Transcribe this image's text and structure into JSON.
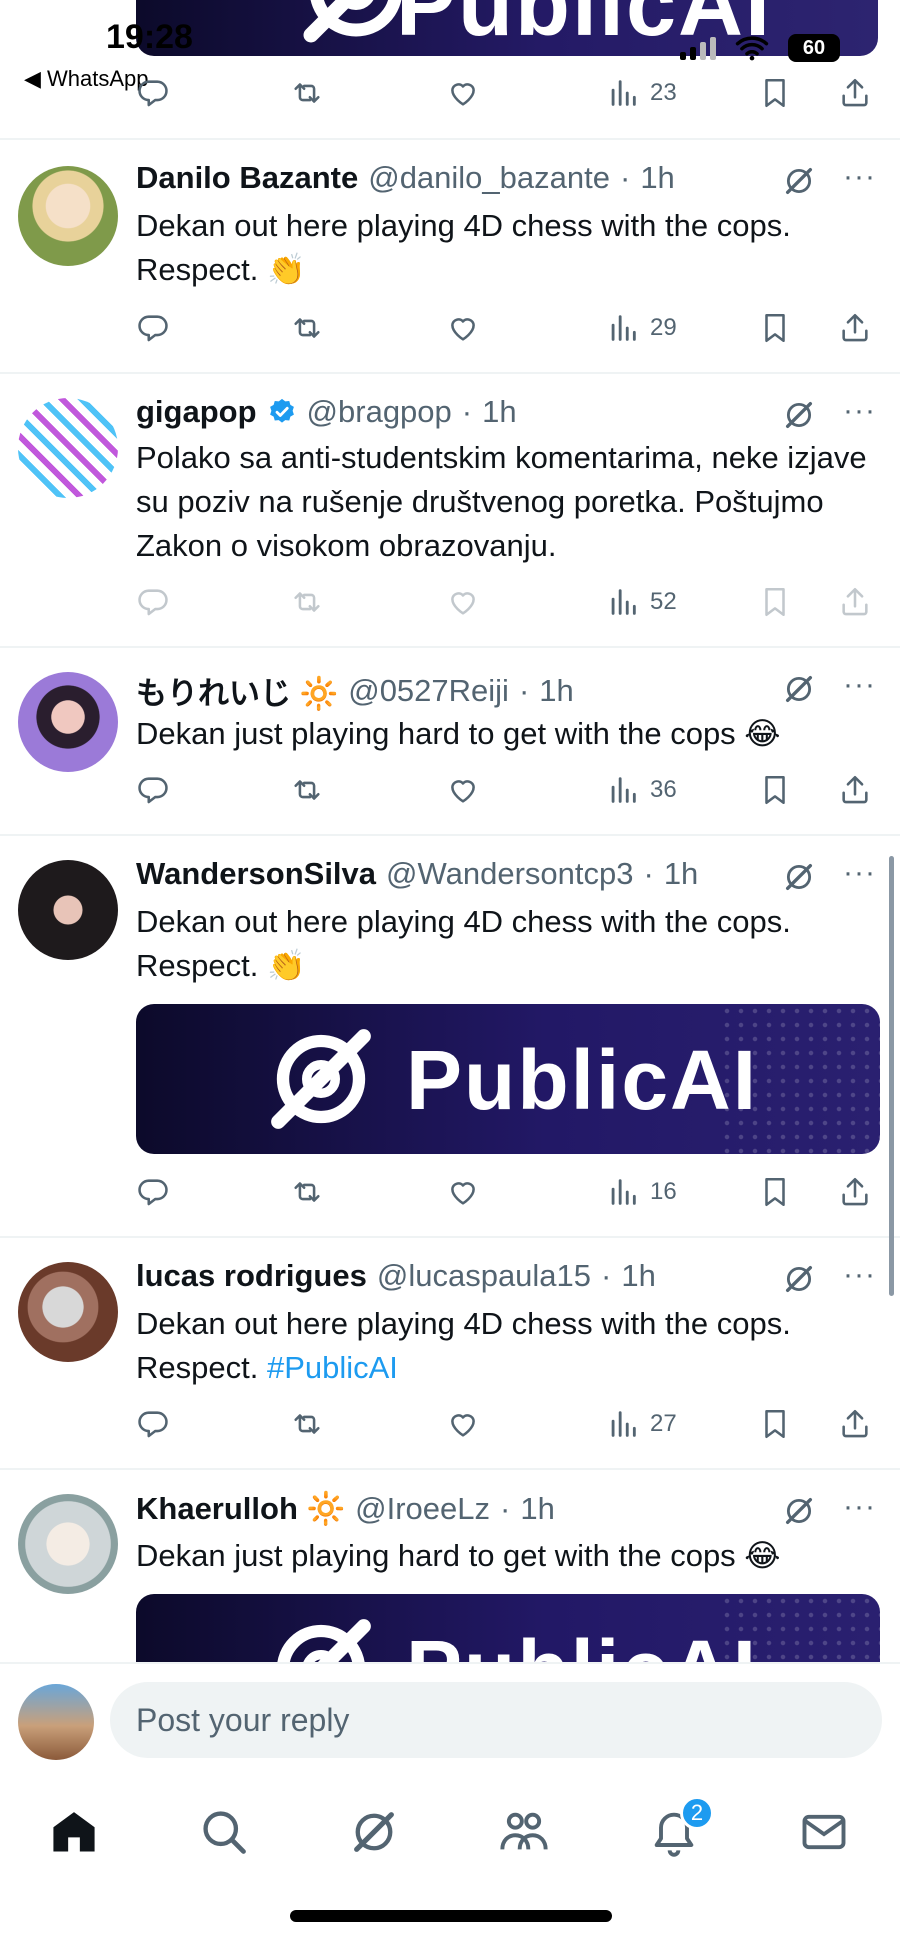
{
  "status_bar": {
    "time": "19:28",
    "back_app": "◀ WhatsApp",
    "battery": "60"
  },
  "top_banner": {
    "brand": "PublicAI"
  },
  "top_actions": {
    "views": "23"
  },
  "tweets": [
    {
      "name": "Danilo Bazante",
      "handle": "@danilo_bazante",
      "time": "1h",
      "text": "Dekan out here playing 4D chess with the cops. Respect. 👏",
      "views": "29"
    },
    {
      "name": "gigapop",
      "handle": "@bragpop",
      "time": "1h",
      "text": "Polako sa anti-studentskim komentarima, neke izjave su poziv na rušenje društvenog poretka. Poštujmo Zakon o visokom obrazovanju.",
      "views": "52"
    },
    {
      "name": "もりれいじ 🔆",
      "handle": "@0527Reiji",
      "time": "1h",
      "text": "Dekan just playing hard to get with the cops 😂",
      "views": "36"
    },
    {
      "name": "WandersonSilva",
      "handle": "@Wandersontcp3",
      "time": "1h",
      "text": "Dekan out here playing 4D chess with the cops. Respect. 👏",
      "media_brand": "PublicAI",
      "views": "16"
    },
    {
      "name": "lucas rodrigues",
      "handle": "@lucaspaula15",
      "time": "1h",
      "text_plain": "Dekan out here playing 4D chess with the cops. Respect. ",
      "hashtag": "#PublicAI",
      "views": "27"
    },
    {
      "name": "Khaerulloh 🔆",
      "handle": "@IroeeLz",
      "time": "1h",
      "text": "Dekan just playing hard to get with the cops 😂",
      "media_brand": "PublicAI"
    }
  ],
  "separator": "·",
  "more_label": "···",
  "reply_box": {
    "placeholder": "Post your reply"
  },
  "tabbar": {
    "notifications_badge": "2"
  },
  "colors": {
    "accent": "#1d9bf0",
    "muted": "#536471",
    "text": "#0f1419",
    "divider": "#eff3f4"
  }
}
